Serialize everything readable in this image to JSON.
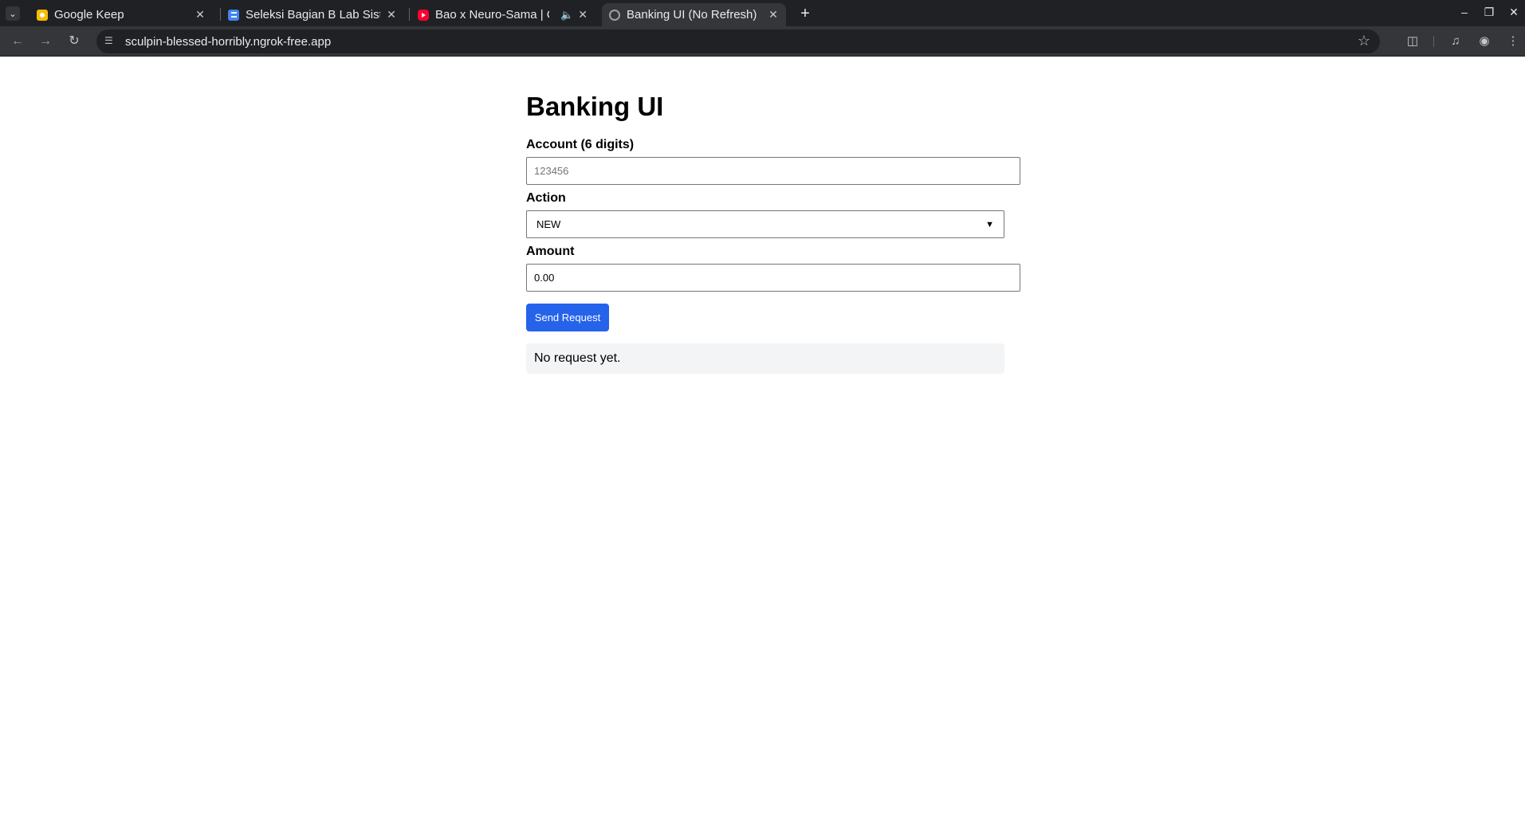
{
  "browser": {
    "tabs": [
      {
        "title": "Google Keep",
        "favicon": "google-keep-icon",
        "color": "#fbbc04"
      },
      {
        "title": "Seleksi Bagian B Lab Sistem",
        "favicon": "google-docs-icon",
        "color": "#4285f4"
      },
      {
        "title": "Bao x Neuro-Sama | Cooking",
        "favicon": "youtube-icon",
        "color": "#ff0033"
      },
      {
        "title": "Banking UI (No Refresh)",
        "favicon": "globe-icon",
        "color": "#9aa0a6"
      }
    ],
    "url": "sculpin-blessed-horribly.ngrok-free.app"
  },
  "page": {
    "title": "Banking UI",
    "account": {
      "label": "Account (6 digits)",
      "placeholder": "123456",
      "value": ""
    },
    "action": {
      "label": "Action",
      "selected": "NEW"
    },
    "amount": {
      "label": "Amount",
      "value": "0.00"
    },
    "submit_label": "Send Request",
    "result_text": "No request yet.",
    "accent_color": "#2563eb"
  }
}
